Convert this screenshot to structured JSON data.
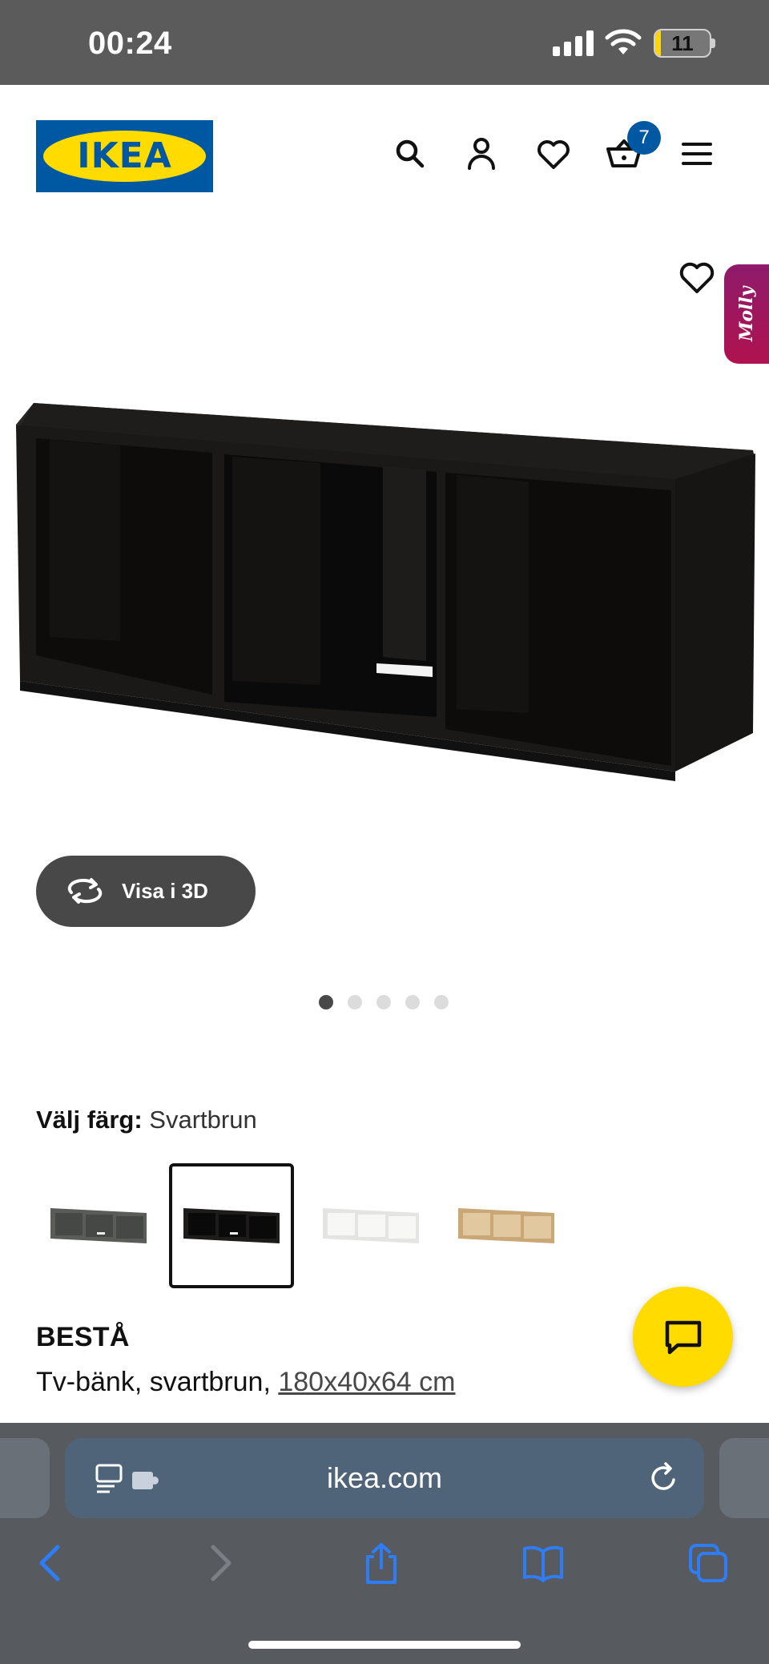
{
  "status_bar": {
    "time": "00:24",
    "battery": "11",
    "battery_fraction": 0.11
  },
  "header": {
    "logo_text": "IKEA",
    "cart_count": "7",
    "icons": [
      "search-icon",
      "account-icon",
      "heart-icon",
      "cart-icon",
      "menu-icon"
    ]
  },
  "product_gallery": {
    "molly_label": "Molly",
    "view3d_label": "Visa i 3D",
    "image_count": 5,
    "active_image": 1
  },
  "color_selector": {
    "label": "Välj färg:",
    "value": "Svartbrun",
    "swatches": [
      {
        "name": "grey",
        "color": "#5a5c58"
      },
      {
        "name": "black-brown",
        "color": "#1a1816",
        "selected": true
      },
      {
        "name": "white",
        "color": "#f4f4f2"
      },
      {
        "name": "white-stained-oak",
        "color": "#d8b88a"
      }
    ]
  },
  "product": {
    "name": "BESTÅ",
    "description": "Tv-bänk, svartbrun, ",
    "dimensions": "180x40x64 cm"
  },
  "browser": {
    "url": "ikea.com"
  },
  "colors": {
    "ikea_blue": "#0058a3",
    "ikea_yellow": "#ffdb00"
  }
}
